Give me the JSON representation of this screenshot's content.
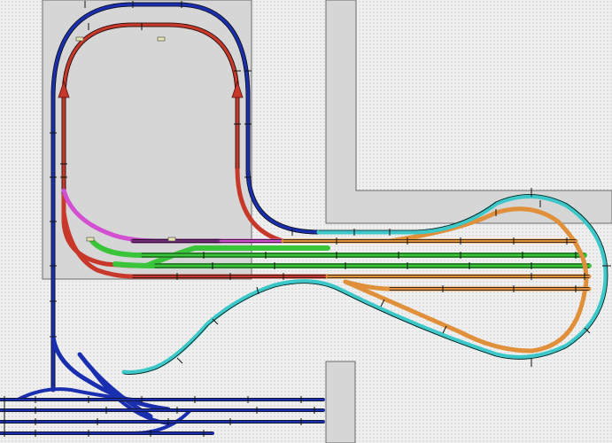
{
  "window": {
    "title": ""
  },
  "layout": {
    "description_visible_text": [],
    "colors": {
      "background": "#efefef",
      "baseboard": "#d6d6d6",
      "baseboard_outline": "#6b6b6b",
      "mainline_blue": "#1a2fb0",
      "inner_loop_red": "#c8382a",
      "yard_green": "#39c43a",
      "return_loop_cyan": "#3cc8c8",
      "siding_orange": "#e0903a",
      "crossover_magenta": "#d24fd2",
      "connector_purple": "#7a2a80"
    },
    "icons": {
      "marker": "track-marker-icon",
      "arrow": "direction-arrow-icon"
    }
  }
}
